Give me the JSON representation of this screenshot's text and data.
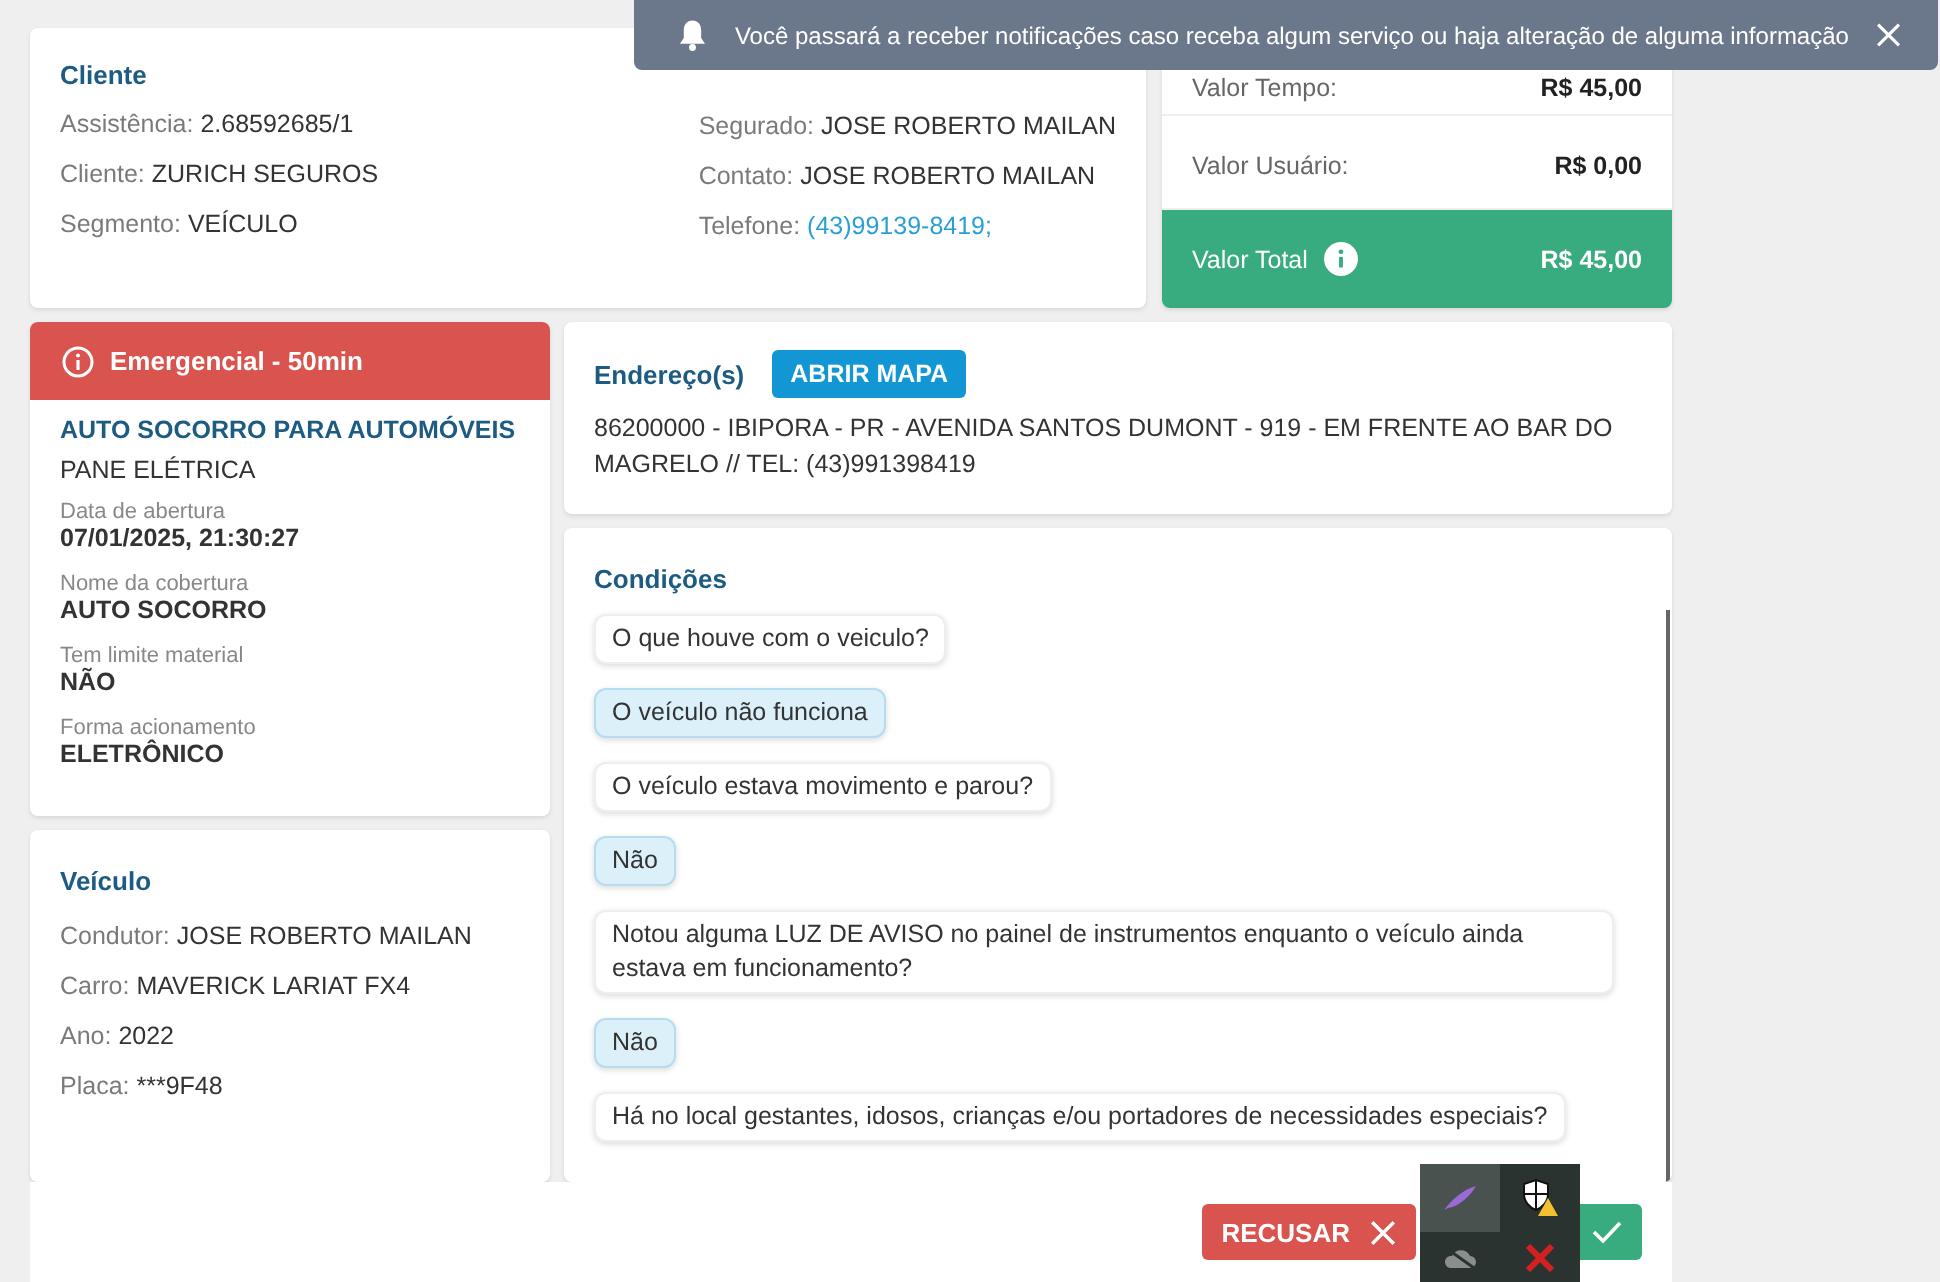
{
  "toast": {
    "text": "Você passará a receber notificações caso receba algum serviço ou haja alteração de alguma informação"
  },
  "client": {
    "title": "Cliente",
    "left": [
      {
        "label": "Assistência:",
        "value": "2.68592685/1",
        "kind": "text"
      },
      {
        "label": "Cliente:",
        "value": "ZURICH SEGUROS",
        "kind": "text"
      },
      {
        "label": "Segmento:",
        "value": "VEÍCULO",
        "kind": "text"
      }
    ],
    "right": [
      {
        "label": "Segurado:",
        "value": "JOSE ROBERTO MAILAN",
        "kind": "text"
      },
      {
        "label": "Contato:",
        "value": "JOSE ROBERTO MAILAN",
        "kind": "text"
      },
      {
        "label": "Telefone:",
        "value": "(43)99139-8419;",
        "kind": "link"
      }
    ]
  },
  "values": [
    {
      "label": "Valor Tempo:",
      "value": "R$ 45,00",
      "kind": "plain"
    },
    {
      "label": "Valor Usuário:",
      "value": "R$ 0,00",
      "kind": "plain"
    },
    {
      "label": "Valor Total",
      "value": "R$ 45,00",
      "kind": "total"
    }
  ],
  "service": {
    "badge": "Emergencial - 50min",
    "title": "AUTO SOCORRO PARA AUTOMÓVEIS",
    "subtitle": "PANE ELÉTRICA",
    "details": [
      {
        "label": "Data de abertura",
        "value": "07/01/2025, 21:30:27"
      },
      {
        "label": "Nome da cobertura",
        "value": "AUTO SOCORRO"
      },
      {
        "label": "Tem limite material",
        "value": "NÃO"
      },
      {
        "label": "Forma acionamento",
        "value": "ELETRÔNICO"
      }
    ]
  },
  "vehicle": {
    "title": "Veículo",
    "fields": [
      {
        "label": "Condutor:",
        "value": "JOSE ROBERTO MAILAN"
      },
      {
        "label": "Carro:",
        "value": "MAVERICK LARIAT FX4"
      },
      {
        "label": "Ano:",
        "value": "2022"
      },
      {
        "label": "Placa:",
        "value": "***9F48"
      }
    ]
  },
  "address": {
    "title": "Endereço(s)",
    "button": "ABRIR MAPA",
    "text": "86200000 - IBIPORA - PR - AVENIDA SANTOS DUMONT - 919 - EM FRENTE AO BAR DO MAGRELO // TEL: (43)991398419"
  },
  "conditions": {
    "title": "Condições",
    "items": [
      {
        "kind": "question",
        "text": "O que houve com o veiculo?"
      },
      {
        "kind": "answer",
        "text": "O veículo não funciona"
      },
      {
        "kind": "question",
        "text": "O veículo estava movimento e parou?"
      },
      {
        "kind": "answer",
        "text": "Não"
      },
      {
        "kind": "question",
        "text": "Notou alguma LUZ DE AVISO no painel de instrumentos enquanto o veículo ainda estava em funcionamento?"
      },
      {
        "kind": "answer",
        "text": "Não"
      },
      {
        "kind": "question",
        "text": "Há no local gestantes, idosos, crianças e/ou portadores de necessidades especiais?"
      }
    ]
  },
  "footer": {
    "buttons": [
      {
        "kind": "reject",
        "label": "RECUSAR"
      },
      {
        "kind": "accept"
      }
    ]
  }
}
